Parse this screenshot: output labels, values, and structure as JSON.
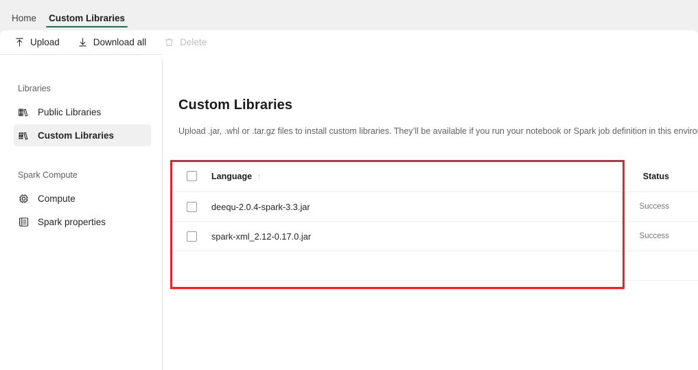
{
  "tabs": [
    {
      "label": "Home",
      "active": false
    },
    {
      "label": "Custom Libraries",
      "active": true
    }
  ],
  "toolbar": {
    "upload_label": "Upload",
    "download_all_label": "Download all",
    "delete_label": "Delete"
  },
  "sidebar": {
    "groups": [
      {
        "label": "Libraries",
        "items": [
          {
            "label": "Public Libraries",
            "icon": "public-libraries-icon",
            "selected": false
          },
          {
            "label": "Custom Libraries",
            "icon": "custom-libraries-icon",
            "selected": true
          }
        ]
      },
      {
        "label": "Spark Compute",
        "items": [
          {
            "label": "Compute",
            "icon": "cpu-chip-icon",
            "selected": false
          },
          {
            "label": "Spark properties",
            "icon": "properties-list-icon",
            "selected": false
          }
        ]
      }
    ]
  },
  "main": {
    "title": "Custom Libraries",
    "description": "Upload .jar, .whl or .tar.gz files to install custom libraries. They’ll be available if you run your notebook or Spark job definition in this environment",
    "table": {
      "columns": {
        "language": "Language",
        "sort_indicator": "↑",
        "status": "Status"
      },
      "rows": [
        {
          "language": "deequ-2.0.4-spark-3.3.jar",
          "status": "Success"
        },
        {
          "language": "spark-xml_2.12-0.17.0.jar",
          "status": "Success"
        }
      ]
    }
  },
  "colors": {
    "accent_green": "#1a6e52",
    "annotation_red": "#ee2222",
    "page_bg": "#f0f0f0",
    "selected_nav_bg": "#f0f0f0"
  }
}
